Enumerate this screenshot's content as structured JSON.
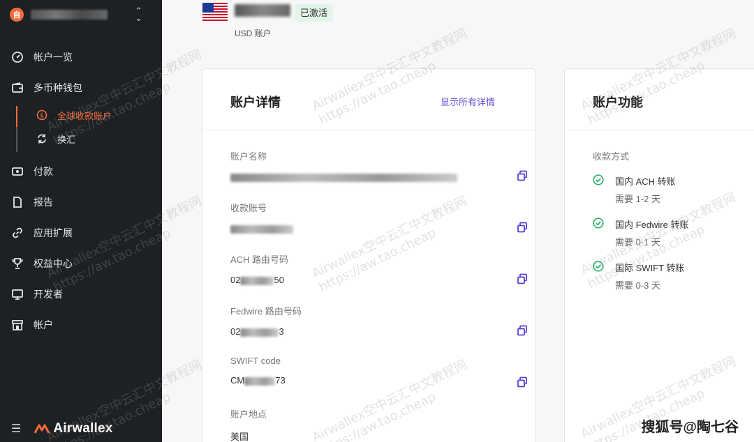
{
  "sidebar": {
    "org_logo": "自",
    "items": [
      {
        "label": "帐户一览",
        "icon": "dashboard-icon"
      },
      {
        "label": "多币种钱包",
        "icon": "wallet-icon"
      },
      {
        "label": "付款",
        "icon": "payment-icon"
      },
      {
        "label": "报告",
        "icon": "report-icon"
      },
      {
        "label": "应用扩展",
        "icon": "link-icon"
      },
      {
        "label": "权益中心",
        "icon": "trophy-icon"
      },
      {
        "label": "开发者",
        "icon": "monitor-icon"
      },
      {
        "label": "帐户",
        "icon": "store-icon"
      }
    ],
    "sub_items": [
      {
        "label": "全球收款账户",
        "icon": "dollar-circle-icon",
        "active": true
      },
      {
        "label": "换汇",
        "icon": "exchange-icon",
        "active": false
      }
    ],
    "brand": "Airwallex",
    "accent": "#f26b3a"
  },
  "header": {
    "status": "已激活",
    "currency_label": "USD 账户"
  },
  "details": {
    "title": "账户详情",
    "show_all": "显示所有详情",
    "fields": [
      {
        "label": "账户名称",
        "value_visible": "... Wu ... ..u Dian Zi Shang Wu You ..."
      },
      {
        "label": "收款账号",
        "value_visible": "..."
      },
      {
        "label": "ACH 路由号码",
        "prefix": "02",
        "suffix": "50"
      },
      {
        "label": "Fedwire 路由号码",
        "prefix": "02",
        "suffix": "3"
      },
      {
        "label": "SWIFT code",
        "prefix": "CM",
        "suffix": "73"
      },
      {
        "label": "账户地点",
        "value": "美国"
      }
    ]
  },
  "features": {
    "title": "账户功能",
    "method_label": "收款方式",
    "methods": [
      {
        "title": "国内 ACH 转账",
        "time": "需要 1-2 天"
      },
      {
        "title": "国内 Fedwire 转账",
        "time": "需要 0-1 天"
      },
      {
        "title": "国际 SWIFT 转账",
        "time": "需要 0-3 天"
      }
    ]
  },
  "watermark": {
    "line1": "Airwallex空中云汇中文教程网",
    "line2": "https://aw.tao.cheap"
  },
  "credit": "搜狐号@陶七谷",
  "colors": {
    "link": "#6a4cd8",
    "check": "#2fb36a",
    "copy": "#5b3fd1"
  }
}
